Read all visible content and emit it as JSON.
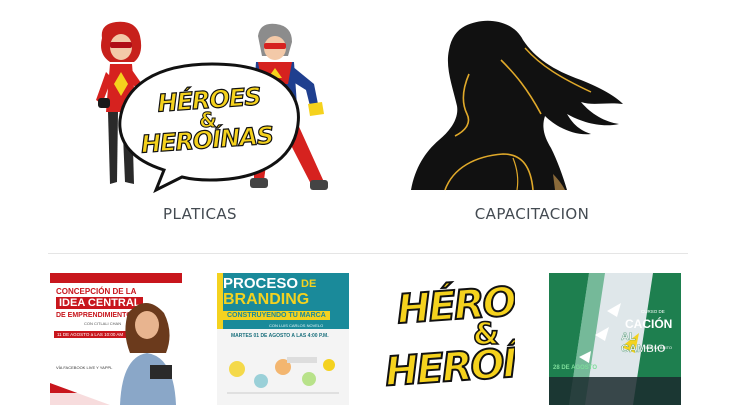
{
  "top_cards": [
    {
      "caption": "PLATICAS",
      "bubble_top": "HÉROES",
      "bubble_amp": "&",
      "bubble_bottom": "HEROÍNAS"
    },
    {
      "caption": "CAPACITACION"
    }
  ],
  "thumbnails": [
    {
      "line1": "CONCEPCIÓN DE LA",
      "line2": "IDEA CENTRAL",
      "line3": "DE EMPRENDIMIENTO",
      "line4": "CON CITLALI CHAN",
      "date": "11 DE AGOSTO a LAS 10:00 AM",
      "footer": "VÍA FACEBOOK LIVE Y YAPPL"
    },
    {
      "line1": "PROCESO",
      "line1b": "DE",
      "line2": "BRANDING",
      "line3": "CONSTRUYENDO TU MARCA",
      "line4": "CON LUIS CARLOS NOVELO",
      "date": "MARTES 01 DE AGOSTO A LAS 4:00 P.M."
    },
    {
      "top": "HÉRO",
      "amp": "&",
      "bottom": "HEROÍ"
    },
    {
      "line1": "CURSO DE",
      "line2": "CACIÓN",
      "line3": "AL CAMBIO",
      "line4": "TERESA BRITO",
      "date": "28 DE AGOSTO"
    }
  ],
  "colors": {
    "bubble_text": "#f5d21d",
    "hero_red": "#d6221f",
    "hero_blue": "#1f3f8f",
    "silhouette": "#111111",
    "gold_line": "#e0a92a",
    "caption": "#444b52",
    "thumb1_red": "#c8161d",
    "thumb2_teal": "#1a8a9a",
    "thumb2_yellow": "#f4d21f",
    "thumb4_green": "#1e7f4f"
  },
  "icons": [
    "female-hero-illustration",
    "male-hero-illustration",
    "speech-bubble-logo",
    "woman-silhouette-illustration"
  ]
}
